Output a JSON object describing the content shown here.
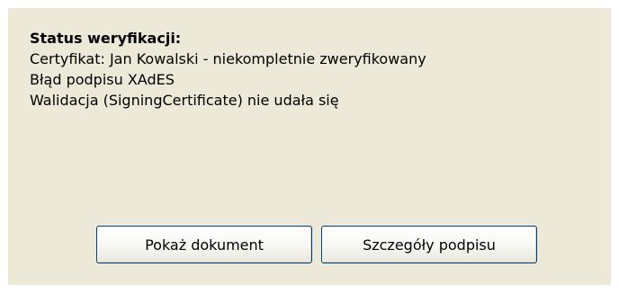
{
  "verification": {
    "title": "Status weryfikacji:",
    "lines": [
      "Certyfikat: Jan Kowalski - niekompletnie zweryfikowany",
      "Błąd podpisu XAdES",
      "Walidacja (SigningCertificate) nie udała się"
    ]
  },
  "buttons": {
    "show_document": "Pokaż dokument",
    "signature_details": "Szczegóły podpisu"
  }
}
